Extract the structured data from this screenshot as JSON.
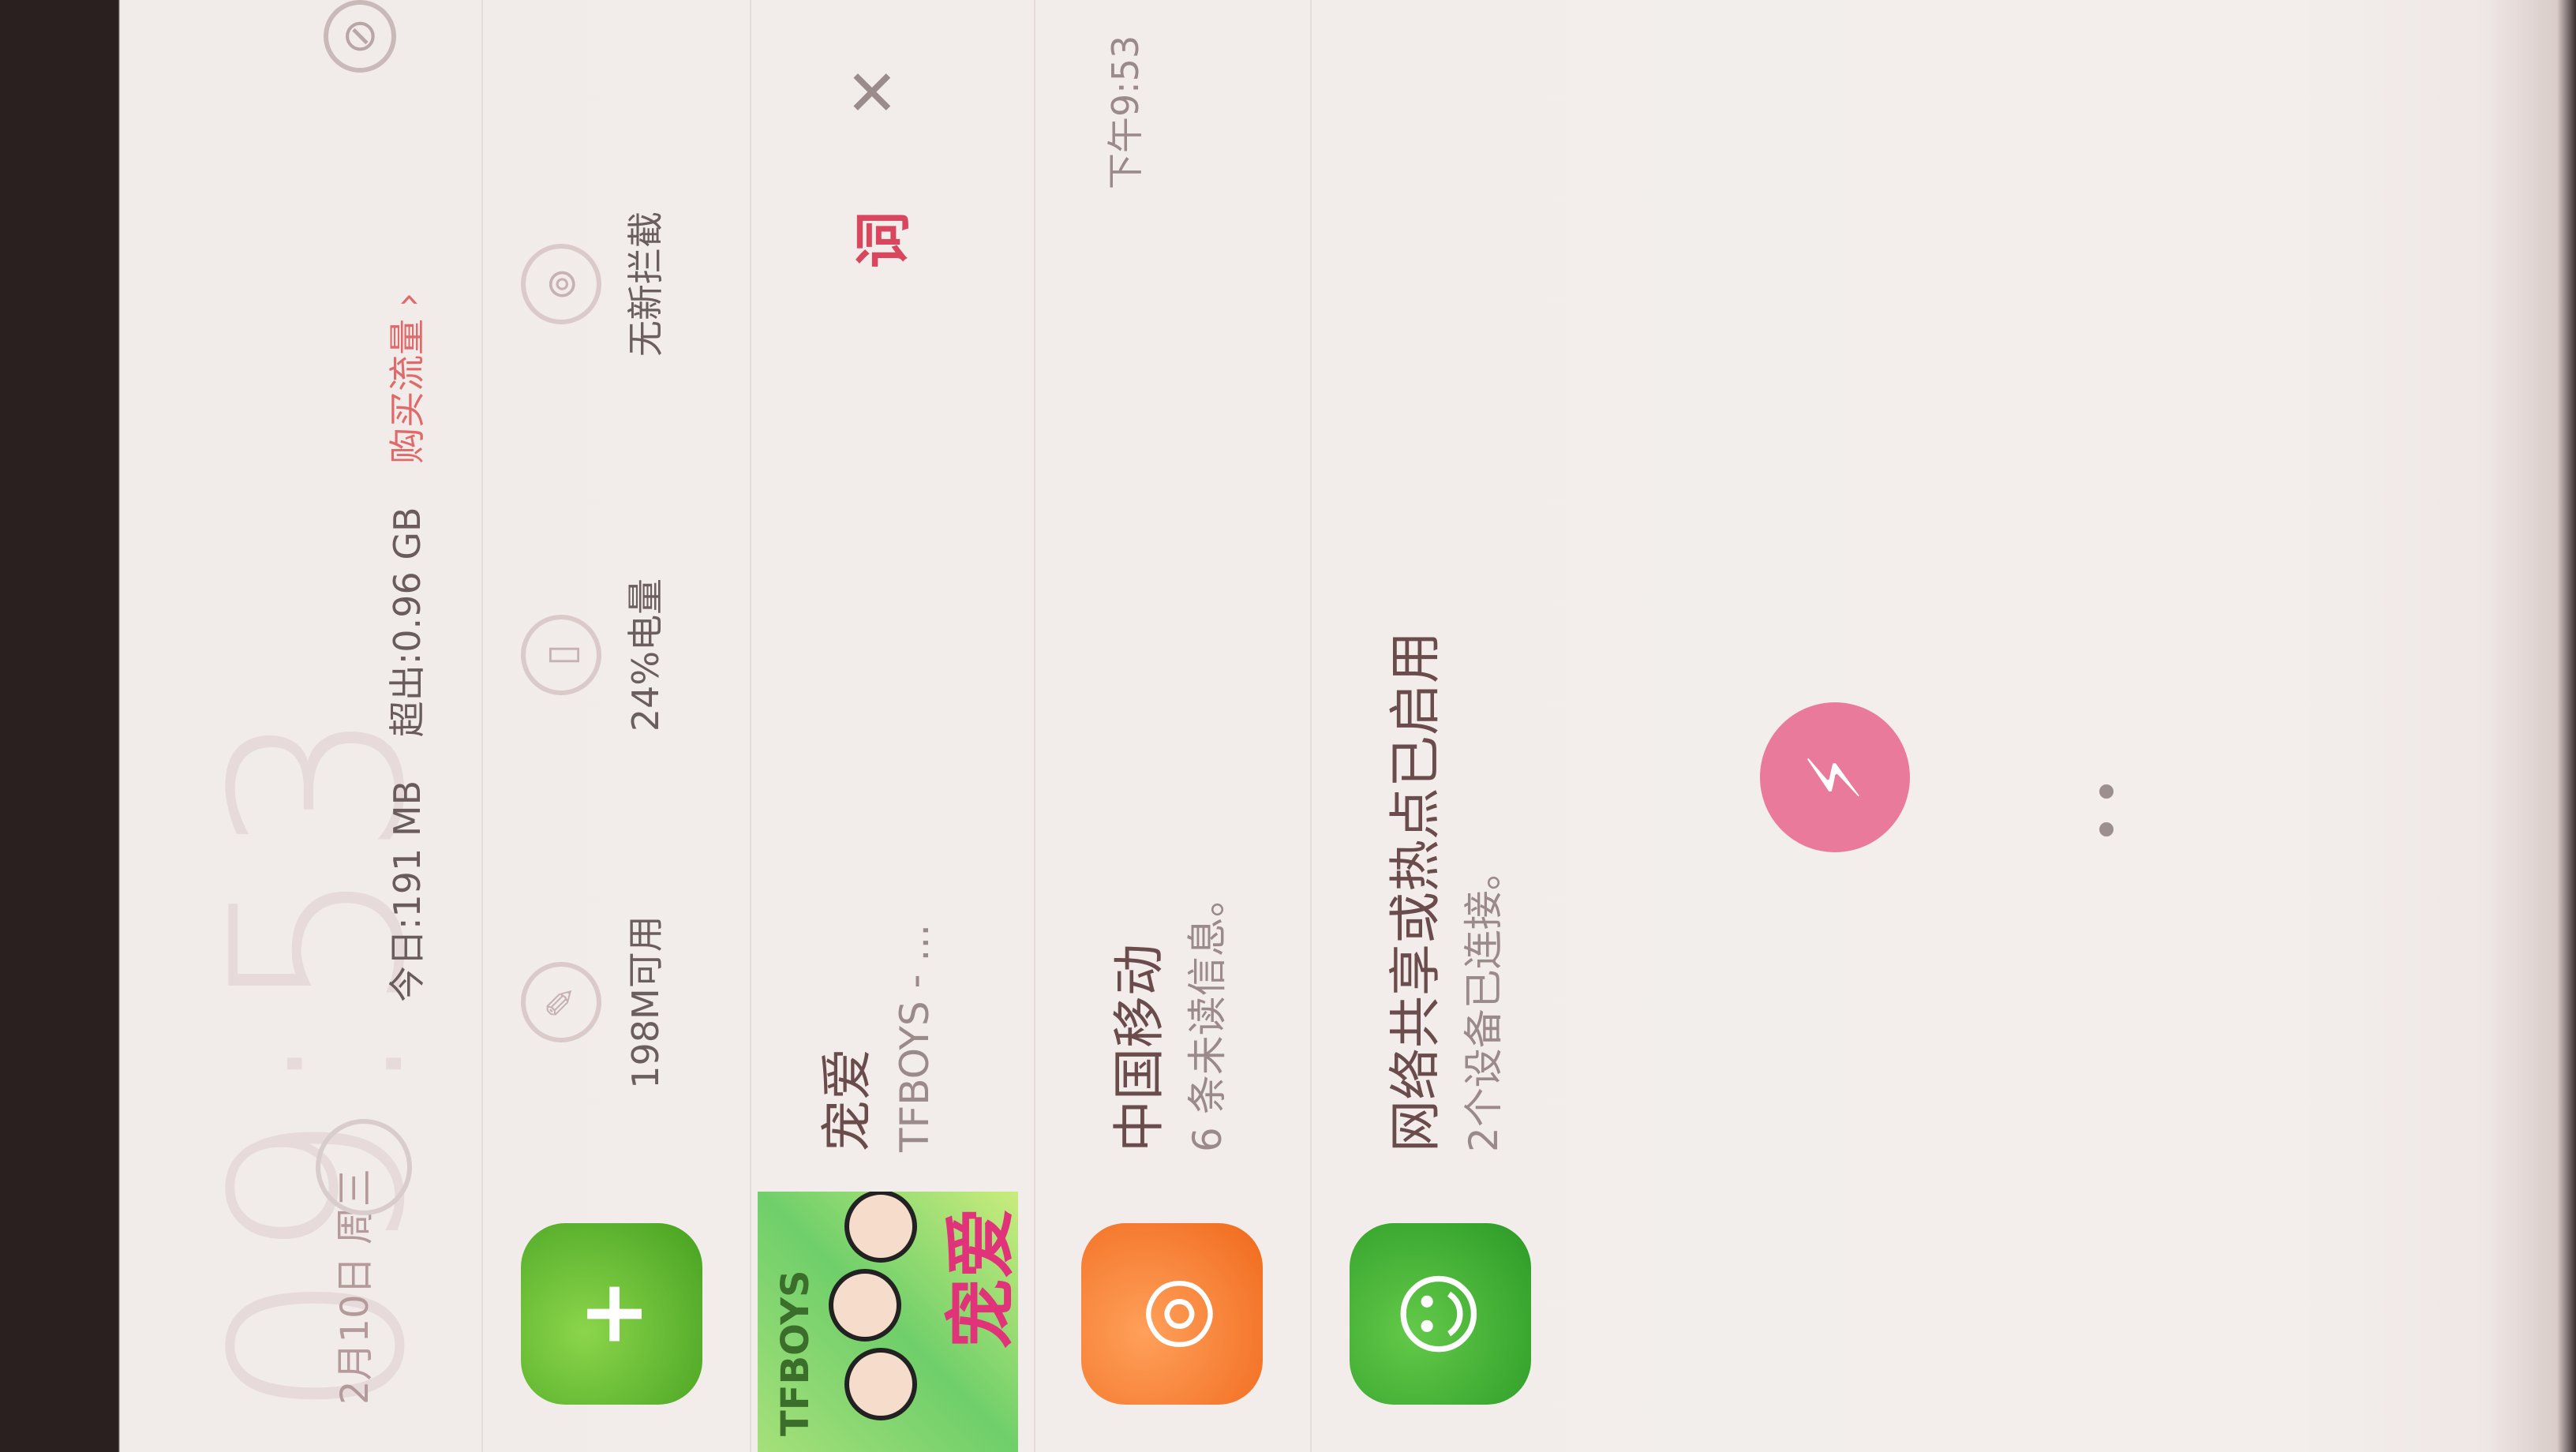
{
  "status": {
    "clock": "09:53",
    "date": "2月10日 周三"
  },
  "traffic": {
    "today": "今日:191 MB",
    "over": "超出:0.96 GB",
    "buy": "购买流量 ›"
  },
  "security_card": {
    "memory": "198M可用",
    "battery": "24%电量",
    "intercept": "无新拦截"
  },
  "music": {
    "song": "宠爱",
    "artist": "TFBOYS - ...",
    "album_text": "TFBOYS",
    "album_title": "宠爱",
    "lyric_label": "词",
    "close_label": "✕"
  },
  "sms": {
    "title": "中国移动",
    "message": "6 条未读信息。",
    "time": "下午9:53"
  },
  "hotspot": {
    "title": "网络共享或热点已启用",
    "message": "2个设备已连接。"
  },
  "icons": {
    "flashlight": "flashlight-icon",
    "shield": "shield-icon",
    "chat": "chat-icon",
    "robot": "robot-icon"
  }
}
